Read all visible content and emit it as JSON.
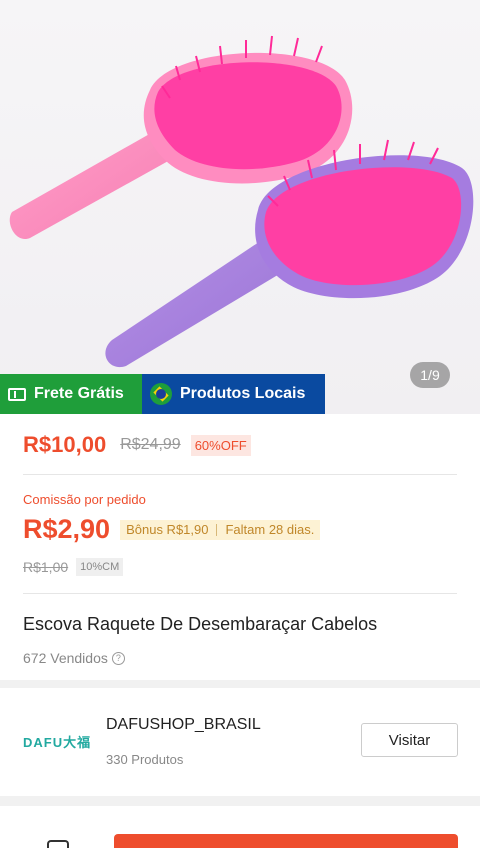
{
  "hero": {
    "image_counter": "1/9",
    "badges": {
      "frete": "Frete Grátis",
      "locais": "Produtos Locais"
    }
  },
  "pricing": {
    "price_now": "R$10,00",
    "price_old": "R$24,99",
    "discount": "60%OFF",
    "commission_label": "Comissão por pedido",
    "commission_value": "R$2,90",
    "bonus": "Bônus R$1,90",
    "remaining": "Faltam 28 dias.",
    "cm_old": "R$1,00",
    "cm_rate": "10%CM"
  },
  "product": {
    "title": "Escova Raquete De Desembaraçar Cabelos",
    "sold": "672 Vendidos"
  },
  "shop": {
    "logo_text": "DAFU大福",
    "name": "DAFUSHOP_BRASIL",
    "products": "330 Produtos",
    "visit_label": "Visitar"
  },
  "colors": {
    "accent": "#ee4d2d",
    "frete_green": "#1f9e3a",
    "locais_blue": "#0a4aa0"
  }
}
